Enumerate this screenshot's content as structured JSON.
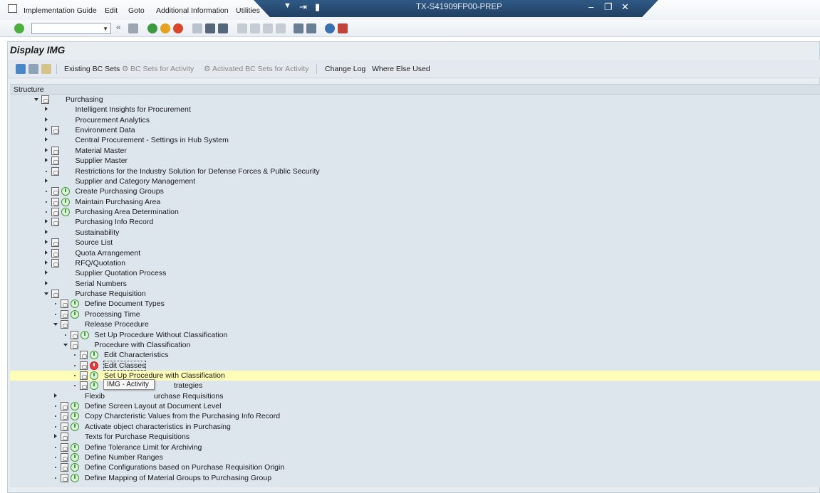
{
  "menu": [
    "Implementation Guide",
    "Edit",
    "Goto",
    "Additional Information",
    "Utilities"
  ],
  "window_title": "TX-S41909FP00-PREP",
  "page_title": "Display IMG",
  "app_toolbar": {
    "existing_bc_sets": "Existing BC Sets",
    "bc_sets_for_activity": "BC Sets for Activity",
    "activated_bc_sets": "Activated BC Sets for Activity",
    "change_log": "Change Log",
    "where_else_used": "Where Else Used"
  },
  "structure_header": "Structure",
  "tree": [
    {
      "label": "Purchasing"
    },
    {
      "label": "Intelligent Insights for Procurement"
    },
    {
      "label": "Procurement Analytics"
    },
    {
      "label": "Environment Data"
    },
    {
      "label": "Central Procurement - Settings in Hub System"
    },
    {
      "label": "Material Master"
    },
    {
      "label": "Supplier Master"
    },
    {
      "label": "Restrictions for the Industry Solution for Defense Forces & Public Security"
    },
    {
      "label": "Supplier and Category Management"
    },
    {
      "label": "Create Purchasing Groups"
    },
    {
      "label": "Maintain Purchasing Area"
    },
    {
      "label": "Purchasing Area Determination"
    },
    {
      "label": "Purchasing Info Record"
    },
    {
      "label": "Sustainability"
    },
    {
      "label": "Source List"
    },
    {
      "label": "Quota Arrangement"
    },
    {
      "label": "RFQ/Quotation"
    },
    {
      "label": "Supplier Quotation Process"
    },
    {
      "label": "Serial Numbers"
    },
    {
      "label": "Purchase Requisition"
    },
    {
      "label": "Define Document Types"
    },
    {
      "label": "Processing Time"
    },
    {
      "label": "Release Procedure"
    },
    {
      "label": "Set Up Procedure Without Classification"
    },
    {
      "label": "Procedure with Classification"
    },
    {
      "label": "Edit Characteristics"
    },
    {
      "label": "Edit Classes"
    },
    {
      "label": "Set Up Procedure with Classification"
    },
    {
      "label": "trategies"
    },
    {
      "label": "Flexib"
    },
    {
      "label": "urchase Requisitions"
    },
    {
      "label": "Define Screen Layout at Document Level"
    },
    {
      "label": "Copy Charcteristic Values from the Purchasing Info Record"
    },
    {
      "label": "Activate object characteristics in Purchasing"
    },
    {
      "label": "Texts for Purchase Requisitions"
    },
    {
      "label": "Define Tolerance Limit for Archiving"
    },
    {
      "label": "Define Number Ranges"
    },
    {
      "label": "Define Configurations based on Purchase Requisition Origin"
    },
    {
      "label": "Define Mapping of Material Groups to Purchasing Group"
    }
  ],
  "tooltip": "IMG - Activity"
}
